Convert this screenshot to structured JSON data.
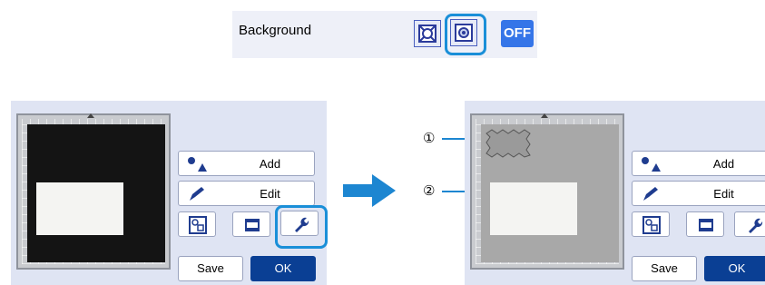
{
  "background_setting": {
    "label": "Background",
    "modes": [
      "scan-full-icon",
      "scan-outline-icon"
    ],
    "off_label": "OFF",
    "highlight_color": "#1a8fd8"
  },
  "screens": {
    "left": {
      "buttons": {
        "add": "Add",
        "edit": "Edit",
        "save": "Save",
        "ok": "OK"
      }
    },
    "right": {
      "buttons": {
        "add": "Add",
        "edit": "Edit",
        "save": "Save",
        "ok": "OK"
      }
    }
  },
  "callouts": {
    "one": "①",
    "two": "②"
  },
  "colors": {
    "ok_button": "#0a3f94",
    "off_button": "#3575e8",
    "arrow": "#1d86d1"
  }
}
